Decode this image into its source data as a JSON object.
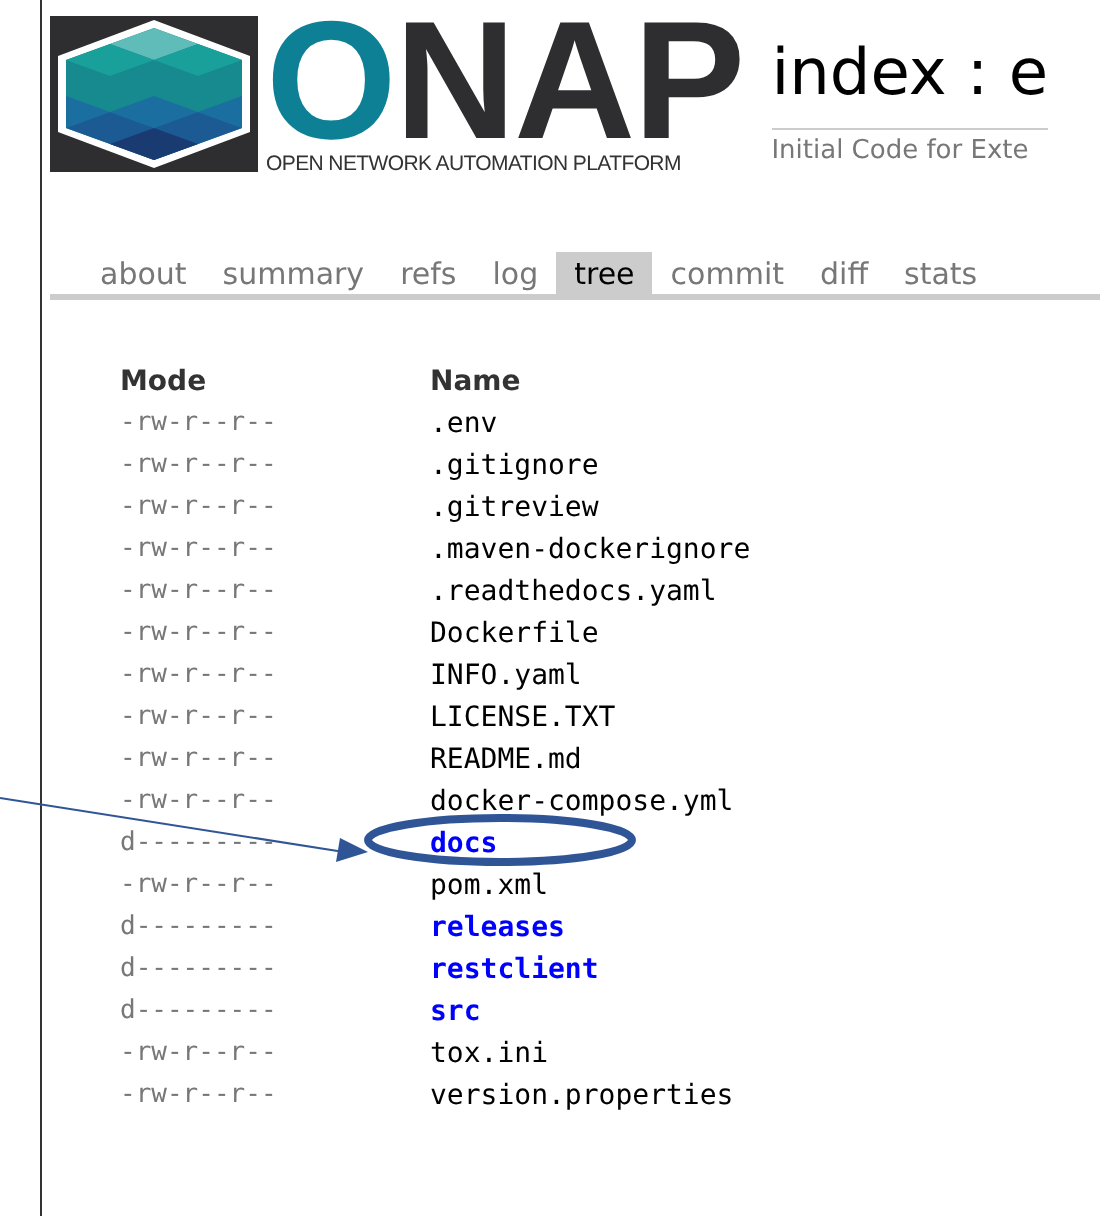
{
  "logo": {
    "mark": "ONAP",
    "tagline": "OPEN NETWORK AUTOMATION PLATFORM"
  },
  "header": {
    "title": "index : e",
    "subtitle": "Initial Code for Exte"
  },
  "tabs": [
    {
      "label": "about",
      "selected": false
    },
    {
      "label": "summary",
      "selected": false
    },
    {
      "label": "refs",
      "selected": false
    },
    {
      "label": "log",
      "selected": false
    },
    {
      "label": "tree",
      "selected": true
    },
    {
      "label": "commit",
      "selected": false
    },
    {
      "label": "diff",
      "selected": false
    },
    {
      "label": "stats",
      "selected": false
    }
  ],
  "table": {
    "columns": [
      "Mode",
      "Name"
    ],
    "rows": [
      {
        "mode": "-rw-r--r--",
        "name": ".env",
        "kind": "file"
      },
      {
        "mode": "-rw-r--r--",
        "name": ".gitignore",
        "kind": "file"
      },
      {
        "mode": "-rw-r--r--",
        "name": ".gitreview",
        "kind": "file"
      },
      {
        "mode": "-rw-r--r--",
        "name": ".maven-dockerignore",
        "kind": "file"
      },
      {
        "mode": "-rw-r--r--",
        "name": ".readthedocs.yaml",
        "kind": "file"
      },
      {
        "mode": "-rw-r--r--",
        "name": "Dockerfile",
        "kind": "file"
      },
      {
        "mode": "-rw-r--r--",
        "name": "INFO.yaml",
        "kind": "file"
      },
      {
        "mode": "-rw-r--r--",
        "name": "LICENSE.TXT",
        "kind": "file"
      },
      {
        "mode": "-rw-r--r--",
        "name": "README.md",
        "kind": "file"
      },
      {
        "mode": "-rw-r--r--",
        "name": "docker-compose.yml",
        "kind": "file"
      },
      {
        "mode": "d---------",
        "name": "docs",
        "kind": "dir"
      },
      {
        "mode": "-rw-r--r--",
        "name": "pom.xml",
        "kind": "file"
      },
      {
        "mode": "d---------",
        "name": "releases",
        "kind": "dir"
      },
      {
        "mode": "d---------",
        "name": "restclient",
        "kind": "dir"
      },
      {
        "mode": "d---------",
        "name": "src",
        "kind": "dir"
      },
      {
        "mode": "-rw-r--r--",
        "name": "tox.ini",
        "kind": "file"
      },
      {
        "mode": "-rw-r--r--",
        "name": "version.properties",
        "kind": "file"
      }
    ]
  }
}
